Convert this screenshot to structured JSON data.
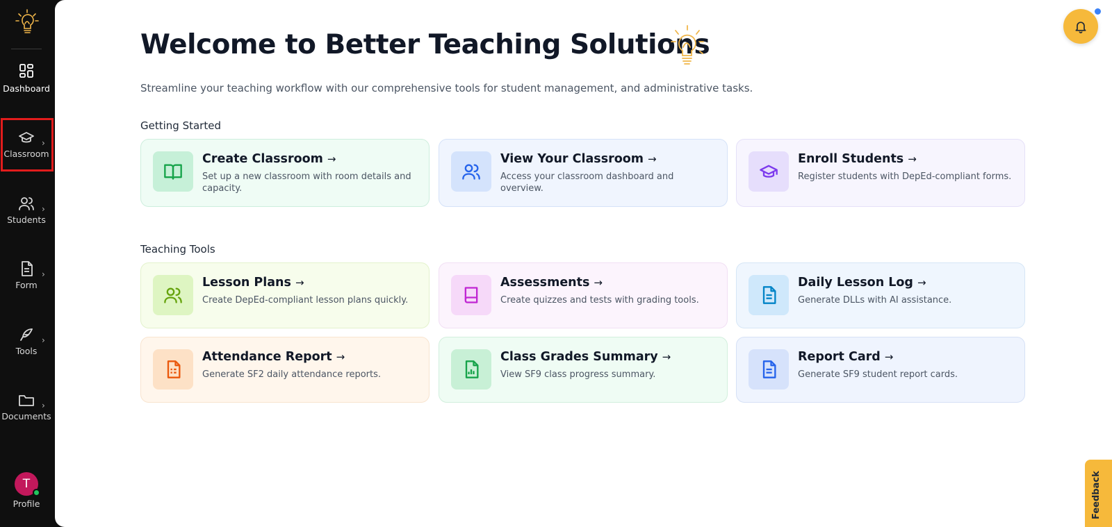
{
  "sidebar": {
    "items": [
      {
        "label": "Dashboard",
        "icon": "dashboard-grid-icon"
      },
      {
        "label": "Classroom",
        "icon": "graduation-cap-icon"
      },
      {
        "label": "Students",
        "icon": "users-icon"
      },
      {
        "label": "Form",
        "icon": "document-form-icon"
      },
      {
        "label": "Tools",
        "icon": "feather-tool-icon"
      },
      {
        "label": "Documents",
        "icon": "folder-icon"
      }
    ],
    "profile": {
      "initial": "T",
      "label": "Profile",
      "avatar_color": "#c2185b",
      "status_color": "#22c55e"
    },
    "highlight_color": "#e21c1c"
  },
  "header": {
    "title": "Welcome to Better Teaching Solutions",
    "subtitle": "Streamline your teaching workflow with our comprehensive tools for student management, and administrative tasks."
  },
  "notifications": {
    "icon": "bell-icon",
    "color": "#f6b93b",
    "has_unread": true
  },
  "getting_started": {
    "title": "Getting Started",
    "cards": [
      {
        "title": "Create Classroom",
        "arrow": "→",
        "desc": "Set up a new classroom with room details and capacity.",
        "icon": "book-open-icon"
      },
      {
        "title": "View Your Classroom",
        "arrow": "→",
        "desc": "Access your classroom dashboard and overview.",
        "icon": "users-icon"
      },
      {
        "title": "Enroll Students",
        "arrow": "→",
        "desc": "Register students with DepEd-compliant forms.",
        "icon": "graduation-cap-icon"
      }
    ]
  },
  "teaching_tools": {
    "title": "Teaching Tools",
    "cards": [
      {
        "title": "Lesson Plans",
        "arrow": "→",
        "desc": "Create DepEd-compliant lesson plans quickly.",
        "icon": "users-icon"
      },
      {
        "title": "Assessments",
        "arrow": "→",
        "desc": "Create quizzes and tests with grading tools.",
        "icon": "book-icon"
      },
      {
        "title": "Daily Lesson Log",
        "arrow": "→",
        "desc": "Generate DLLs with AI assistance.",
        "icon": "file-text-icon"
      },
      {
        "title": "Attendance Report",
        "arrow": "→",
        "desc": "Generate SF2 daily attendance reports.",
        "icon": "file-spreadsheet-icon"
      },
      {
        "title": "Class Grades Summary",
        "arrow": "→",
        "desc": "View SF9 class progress summary.",
        "icon": "file-chart-icon"
      },
      {
        "title": "Report Card",
        "arrow": "→",
        "desc": "Generate SF9 student report cards.",
        "icon": "file-text-icon"
      }
    ]
  },
  "feedback": {
    "label": "Feedback"
  }
}
